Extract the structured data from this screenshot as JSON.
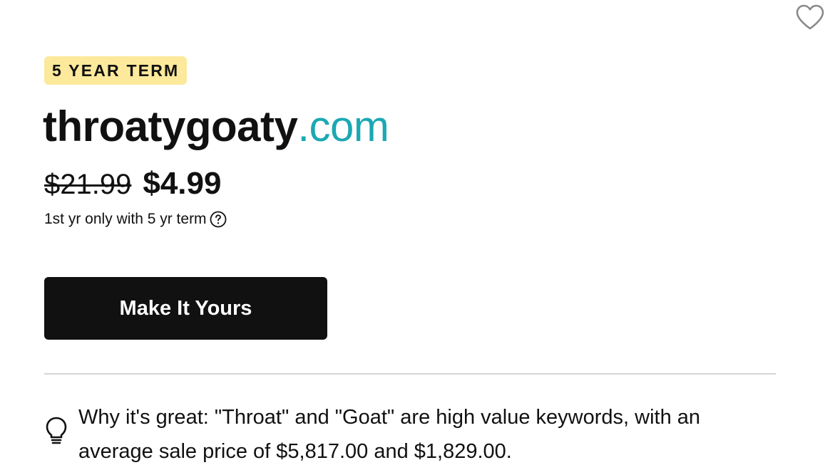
{
  "favorite": {
    "icon": "heart-outline-icon"
  },
  "badge": {
    "label": "5 YEAR TERM",
    "color": "#fde99c"
  },
  "domain": {
    "name": "throatygoaty",
    "tld": ".com",
    "tld_color": "#1ba8b3"
  },
  "pricing": {
    "original_price": "$21.99",
    "sale_price": "$4.99",
    "term_note": "1st yr only with 5 yr term",
    "help_icon": "question-circle-icon"
  },
  "cta": {
    "label": "Make It Yours",
    "color": "#111111"
  },
  "insight": {
    "icon": "lightbulb-icon",
    "text": "Why it's great: \"Throat\" and \"Goat\" are high value keywords, with an average sale price of $5,817.00 and $1,829.00."
  }
}
